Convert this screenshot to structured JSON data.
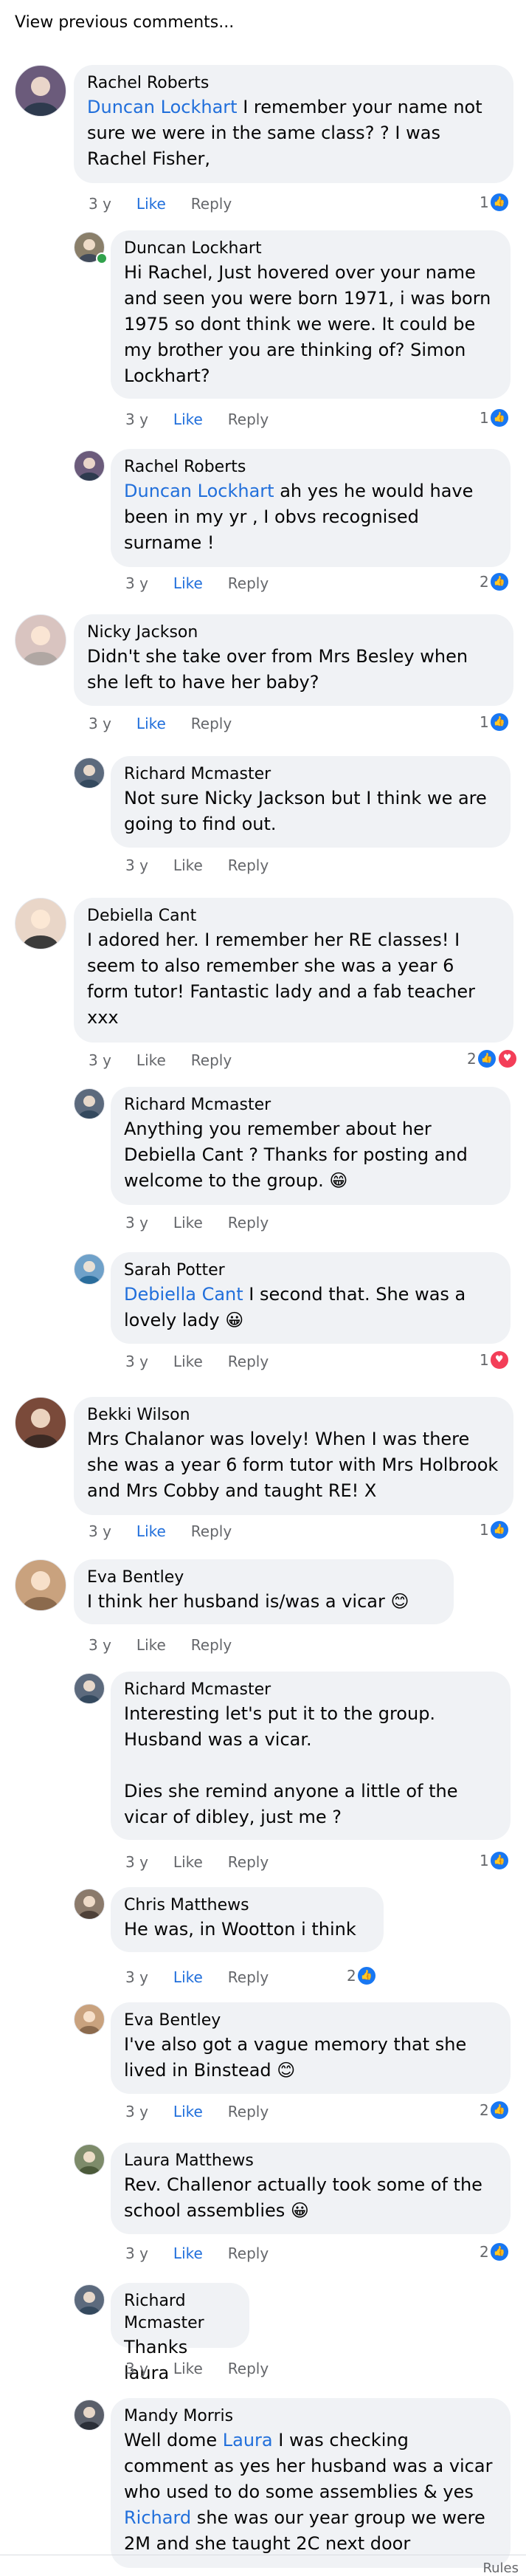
{
  "view_previous": "View previous comments...",
  "comments": [
    {
      "author": "Rachel Roberts",
      "segments": [
        {
          "t": "Duncan Lockhart",
          "m": true
        },
        {
          "t": " I remember your name not sure we were in the same class? ? I was Rachel Fisher,",
          "m": false
        }
      ],
      "age": "3 y",
      "like": "Like",
      "reply": "Reply",
      "like_active": true,
      "reactions": {
        "count": "1",
        "types": [
          "like"
        ]
      }
    },
    {
      "author": "Duncan Lockhart",
      "segments": [
        {
          "t": "Hi Rachel, Just hovered over your name and seen you were born 1971, i was born 1975 so dont think we were. It could be my brother you are thinking of? Simon Lockhart?",
          "m": false
        }
      ],
      "age": "3 y",
      "like": "Like",
      "reply": "Reply",
      "like_active": true,
      "reactions": {
        "count": "1",
        "types": [
          "like"
        ]
      }
    },
    {
      "author": "Rachel Roberts",
      "segments": [
        {
          "t": "Duncan Lockhart",
          "m": true
        },
        {
          "t": " ah yes he would have been in my yr , I obvs recognised surname !",
          "m": false
        }
      ],
      "age": "3 y",
      "like": "Like",
      "reply": "Reply",
      "like_active": true,
      "reactions": {
        "count": "2",
        "types": [
          "like"
        ]
      }
    },
    {
      "author": "Nicky Jackson",
      "segments": [
        {
          "t": "Didn't she take over from Mrs Besley when she left to have her baby?",
          "m": false
        }
      ],
      "age": "3 y",
      "like": "Like",
      "reply": "Reply",
      "like_active": true,
      "reactions": {
        "count": "1",
        "types": [
          "like"
        ]
      }
    },
    {
      "author": "Richard Mcmaster",
      "segments": [
        {
          "t": "Not sure Nicky Jackson but I think we are going to find out.",
          "m": false
        }
      ],
      "age": "3 y",
      "like": "Like",
      "reply": "Reply",
      "like_active": false,
      "reactions": null
    },
    {
      "author": "Debiella Cant",
      "segments": [
        {
          "t": "I adored her. I remember her RE classes! I seem to also remember she was a year 6 form tutor! Fantastic lady and a fab teacher xxx",
          "m": false
        }
      ],
      "age": "3 y",
      "like": "Like",
      "reply": "Reply",
      "like_active": false,
      "reactions": {
        "count": "2",
        "types": [
          "like",
          "love"
        ]
      }
    },
    {
      "author": "Richard Mcmaster",
      "segments": [
        {
          "t": "Anything you remember about her Debiella Cant ? Thanks for posting and welcome to the group. 😁",
          "m": false
        }
      ],
      "age": "3 y",
      "like": "Like",
      "reply": "Reply",
      "like_active": false,
      "reactions": null
    },
    {
      "author": "Sarah Potter",
      "segments": [
        {
          "t": "Debiella Cant",
          "m": true
        },
        {
          "t": " I second that. She was a lovely lady 😀",
          "m": false
        }
      ],
      "age": "3 y",
      "like": "Like",
      "reply": "Reply",
      "like_active": false,
      "reactions": {
        "count": "1",
        "types": [
          "love"
        ]
      }
    },
    {
      "author": "Bekki Wilson",
      "segments": [
        {
          "t": "Mrs Chalanor was lovely! When I was there she was a year 6 form tutor with Mrs Holbrook and Mrs Cobby and taught RE! X",
          "m": false
        }
      ],
      "age": "3 y",
      "like": "Like",
      "reply": "Reply",
      "like_active": true,
      "reactions": {
        "count": "1",
        "types": [
          "like"
        ]
      }
    },
    {
      "author": "Eva Bentley",
      "segments": [
        {
          "t": "I think her husband is/was a vicar 😊",
          "m": false
        }
      ],
      "age": "3 y",
      "like": "Like",
      "reply": "Reply",
      "like_active": false,
      "reactions": null
    },
    {
      "author": "Richard Mcmaster",
      "segments": [
        {
          "t": "Interesting let's put it to the group. Husband was a vicar.\n\nDies she remind anyone a little of the vicar of dibley, just me ?",
          "m": false
        }
      ],
      "age": "3 y",
      "like": "Like",
      "reply": "Reply",
      "like_active": false,
      "reactions": {
        "count": "1",
        "types": [
          "like"
        ]
      }
    },
    {
      "author": "Chris Matthews",
      "segments": [
        {
          "t": "He was, in Wootton i think",
          "m": false
        }
      ],
      "age": "3 y",
      "like": "Like",
      "reply": "Reply",
      "like_active": true,
      "reactions": {
        "count": "2",
        "types": [
          "like"
        ]
      }
    },
    {
      "author": "Eva Bentley",
      "segments": [
        {
          "t": "I've also got a vague memory that she lived in Binstead 😊",
          "m": false
        }
      ],
      "age": "3 y",
      "like": "Like",
      "reply": "Reply",
      "like_active": true,
      "reactions": {
        "count": "2",
        "types": [
          "like"
        ]
      }
    },
    {
      "author": "Laura Matthews",
      "segments": [
        {
          "t": "Rev. Challenor actually took some of the school assemblies 😀",
          "m": false
        }
      ],
      "age": "3 y",
      "like": "Like",
      "reply": "Reply",
      "like_active": true,
      "reactions": {
        "count": "2",
        "types": [
          "like"
        ]
      }
    },
    {
      "author": "Richard Mcmaster",
      "segments": [
        {
          "t": "Thanks laura",
          "m": false
        }
      ],
      "age": "3 y",
      "like": "Like",
      "reply": "Reply",
      "like_active": false,
      "reactions": null
    },
    {
      "author": "Mandy Morris",
      "segments": [
        {
          "t": "Well dome ",
          "m": false
        },
        {
          "t": "Laura",
          "m": true
        },
        {
          "t": " I was checking comment as yes her husband was a vicar who used to do some assemblies & yes ",
          "m": false
        },
        {
          "t": "Richard",
          "m": true
        },
        {
          "t": " she was our year group we were 2M and she taught 2C next door",
          "m": false
        }
      ],
      "age": "",
      "like": "",
      "reply": "",
      "like_active": false,
      "reactions": null
    }
  ],
  "footer_label": "Rules",
  "colors": {
    "accent": "#216fdb",
    "like_blue": "#1877f2",
    "love_red": "#f33e58",
    "bubble": "#f0f2f5",
    "meta": "#65676b"
  }
}
